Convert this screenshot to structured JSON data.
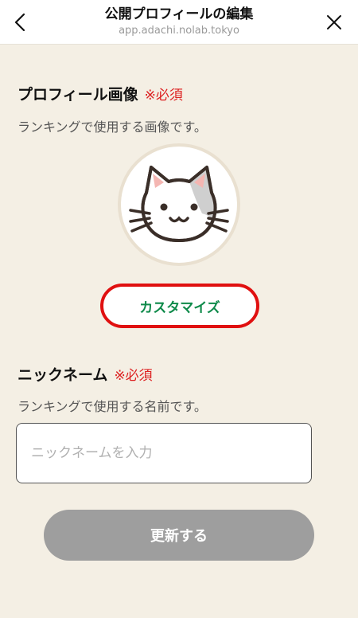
{
  "header": {
    "title": "公開プロフィールの編集",
    "url": "app.adachi.nolab.tokyo",
    "back_icon": "chevron-left-icon",
    "close_icon": "close-icon"
  },
  "profile_image": {
    "title": "プロフィール画像",
    "required": "※必須",
    "description": "ランキングで使用する画像です。",
    "avatar_icon": "cat-face-icon",
    "customize_label": "カスタマイズ"
  },
  "nickname": {
    "title": "ニックネーム",
    "required": "※必須",
    "description": "ランキングで使用する名前です。",
    "placeholder": "ニックネームを入力",
    "value": ""
  },
  "submit": {
    "label": "更新する"
  },
  "colors": {
    "background": "#f4efe4",
    "required": "#dd2222",
    "customize_text": "#0e8a4a",
    "customize_border": "#e01010",
    "submit_disabled": "#9e9e9e"
  }
}
